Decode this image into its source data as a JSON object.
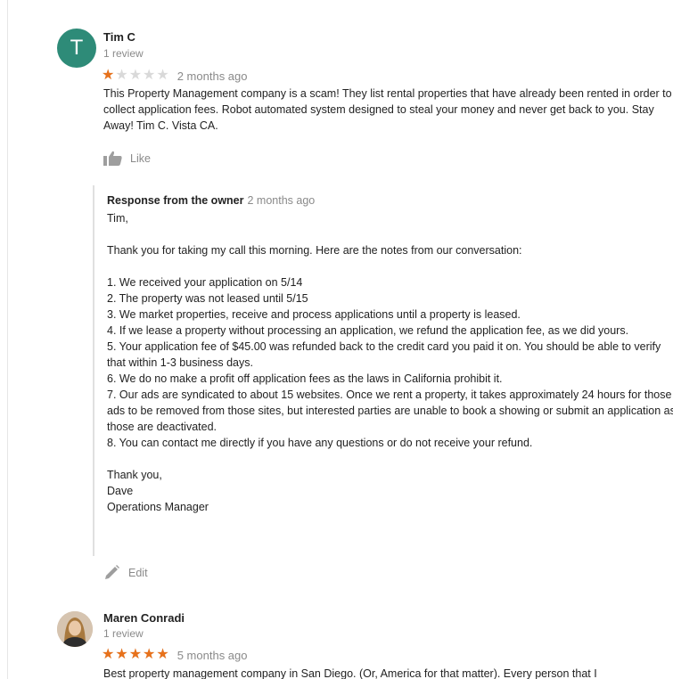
{
  "reviews": [
    {
      "avatar_letter": "T",
      "avatar_color": "#2e8b78",
      "name": "Tim C",
      "count": "1 review",
      "rating": 1,
      "rating_max": 5,
      "date": "2 months ago",
      "text": "This Property Management company is a scam!  They list rental properties that have already been rented in order to collect application fees.  Robot automated system designed to steal your money and never get back to you.  Stay Away!  Tim C. Vista CA.",
      "like_label": "Like",
      "owner_response": {
        "label": "Response from the owner",
        "date": "2 months ago",
        "greeting": "Tim,",
        "intro": "Thank you for taking my call this morning. Here are the notes from our conversation:",
        "points": [
          "1. We received your application on 5/14",
          "2. The property was not leased until 5/15",
          "3. We market properties, receive and process applications until a property is leased.",
          "4. If we lease a property without processing an application, we refund the application fee, as we did yours.",
          "5. Your application fee of $45.00 was refunded back to the credit card you paid it on. You should be able to verify that within 1-3 business days.",
          "6. We do no make a profit off application fees as the laws in California prohibit it.",
          "7. Our ads are syndicated to about 15 websites. Once we rent a property, it takes approximately 24 hours for those ads to be removed from those sites, but interested parties are unable to book a showing or submit an application as those are deactivated.",
          "8. You can contact me directly if you have any questions or do not receive your refund."
        ],
        "closing": "Thank you,",
        "signature_name": "Dave",
        "signature_title": "Operations Manager",
        "edit_label": "Edit"
      }
    },
    {
      "avatar_icon": "profile-photo",
      "name": "Maren Conradi",
      "count": "1 review",
      "rating": 5,
      "rating_max": 5,
      "date": "5 months ago",
      "text": "Best property management company in San Diego. (Or, America for that matter). Every person that I"
    }
  ],
  "colors": {
    "star_filled": "#e7711b",
    "star_empty": "#d9d9d9",
    "muted_text": "#8a8a8a"
  }
}
